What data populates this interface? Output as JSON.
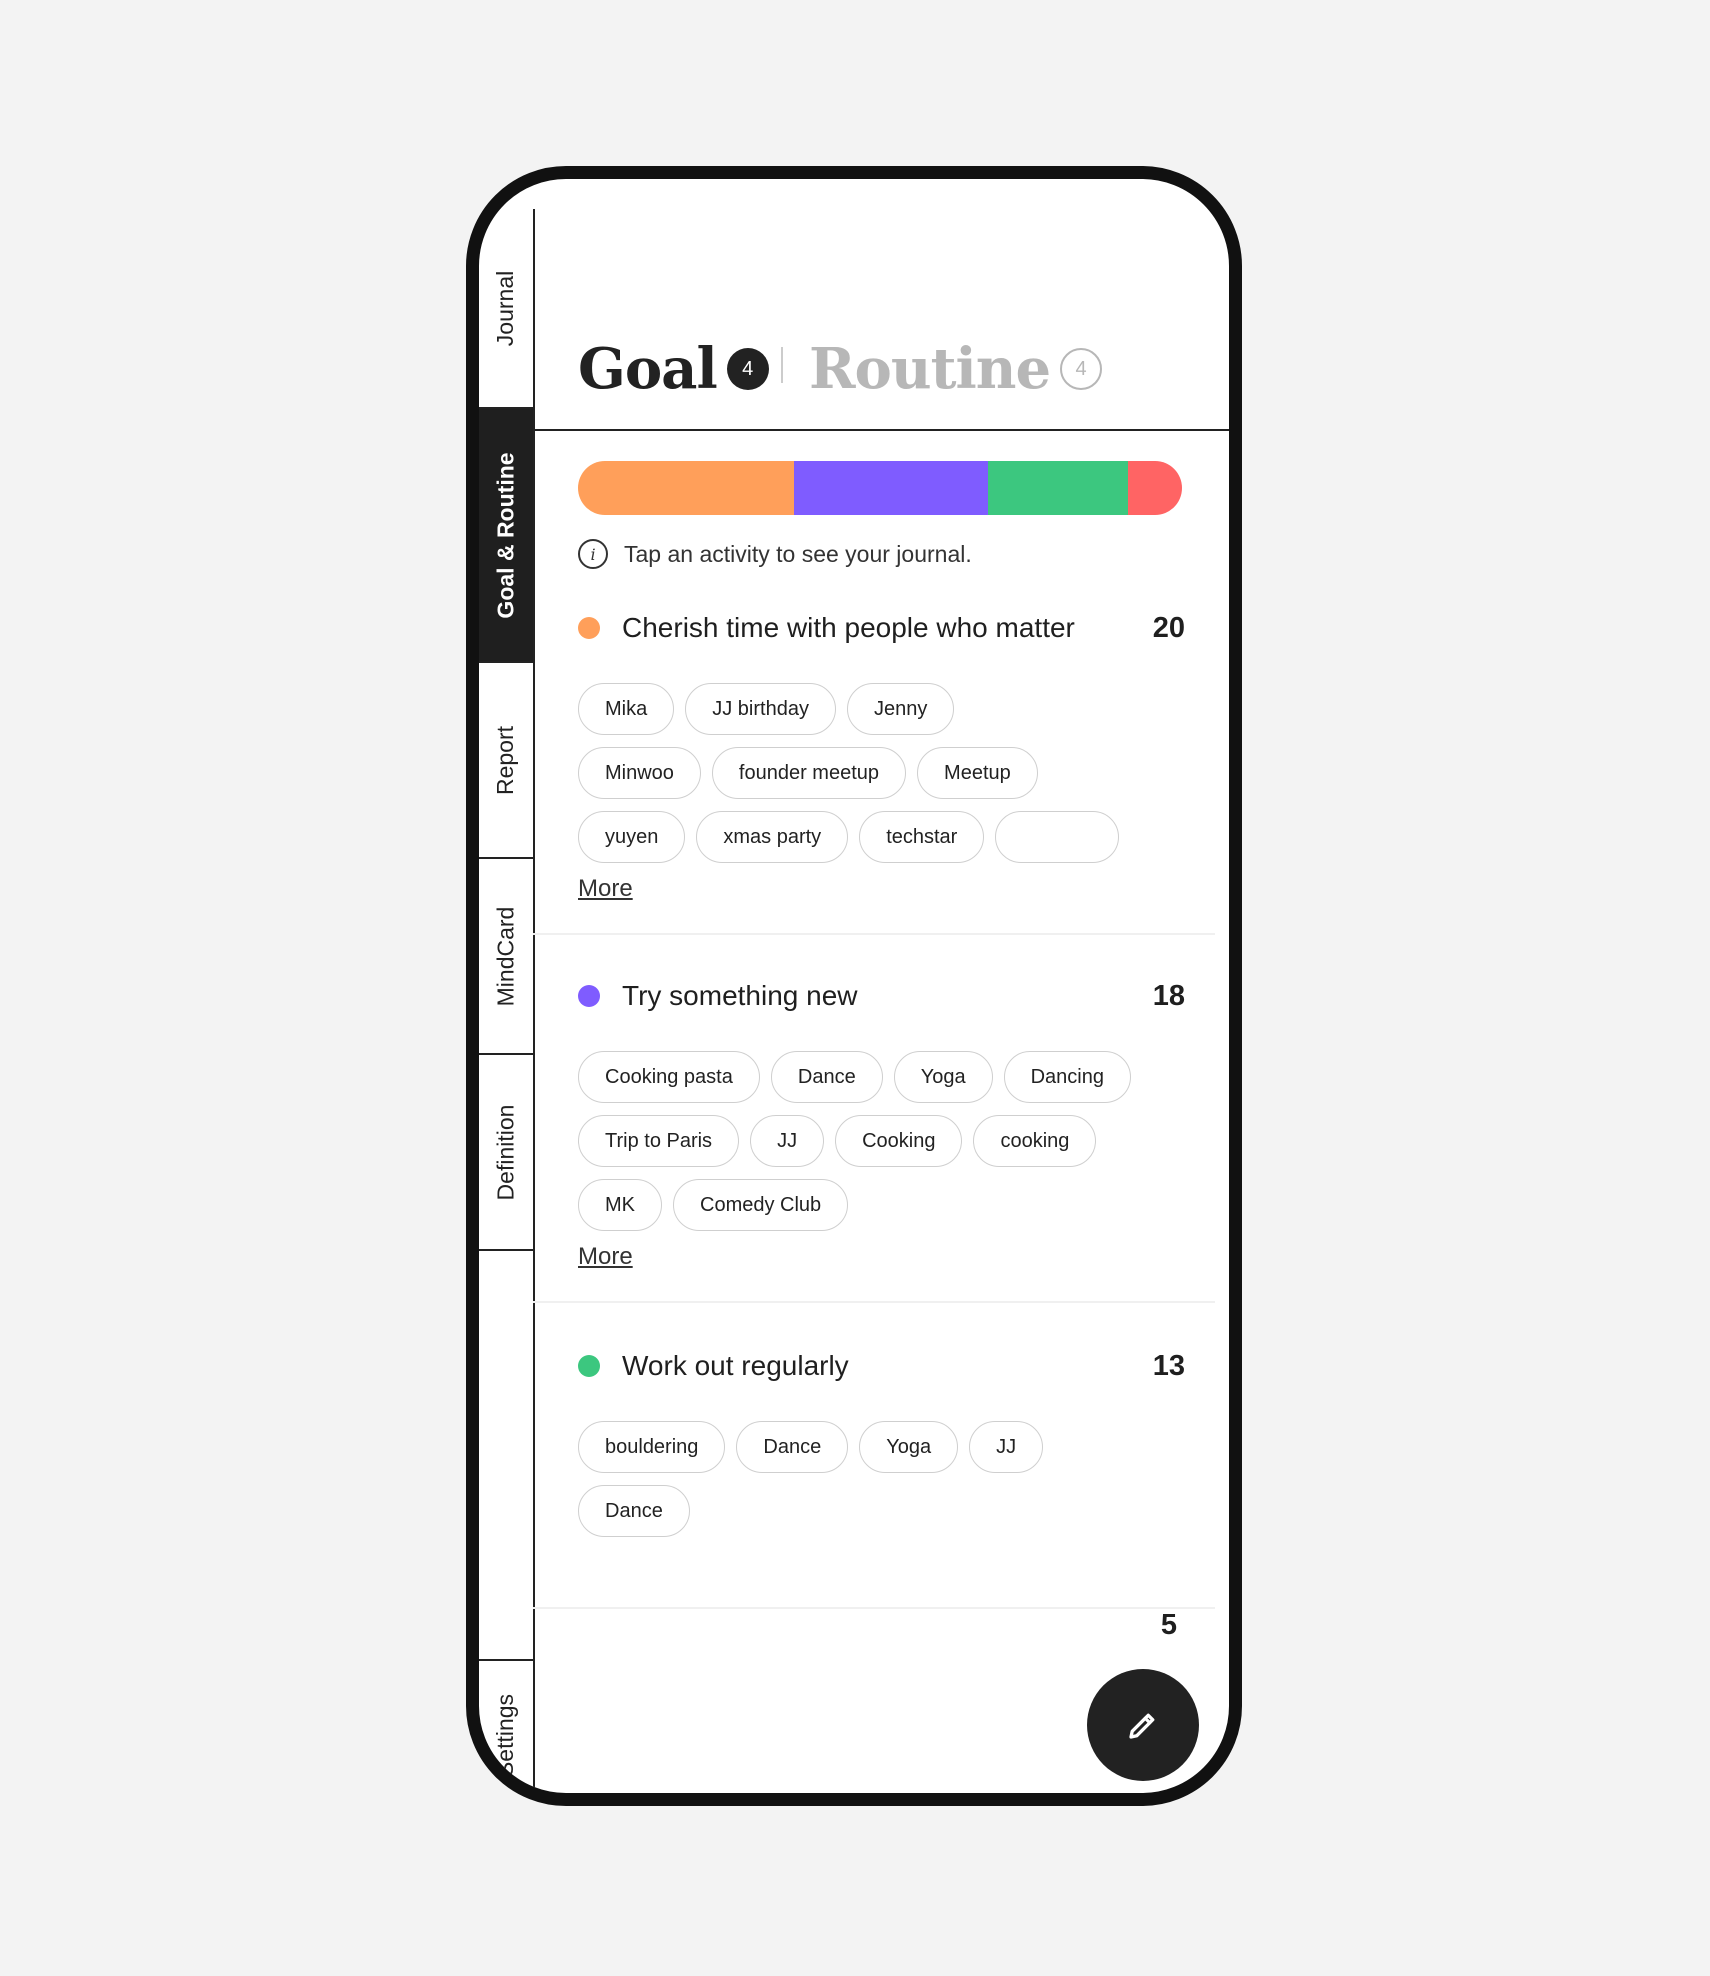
{
  "nav": {
    "items": [
      {
        "label": "Journal"
      },
      {
        "label": "Goal & Routine"
      },
      {
        "label": "Report"
      },
      {
        "label": "MindCard"
      },
      {
        "label": "Definition"
      },
      {
        "label": "Settings"
      }
    ]
  },
  "header": {
    "tabs": [
      {
        "label": "Goal",
        "badge": "4"
      },
      {
        "label": "Routine",
        "badge": "4"
      }
    ]
  },
  "progress": {
    "segments": [
      {
        "color": "#ff9f5a",
        "value": 20
      },
      {
        "color": "#7f5cff",
        "value": 18
      },
      {
        "color": "#3cc77f",
        "value": 13
      },
      {
        "color": "#ff6464",
        "value": 5
      }
    ]
  },
  "info": {
    "icon": "info-icon",
    "text": "Tap an activity to see your journal."
  },
  "goals": [
    {
      "title": "Cherish time with people who matter",
      "count": "20",
      "color": "#ff9f5a",
      "tags": [
        [
          "Mika",
          "JJ birthday",
          "Jenny"
        ],
        [
          "Minwoo",
          "founder meetup",
          "Meetup"
        ],
        [
          "yuyen",
          "xmas party",
          "techstar",
          ""
        ]
      ],
      "more": "More"
    },
    {
      "title": "Try something new",
      "count": "18",
      "color": "#7f5cff",
      "tags": [
        [
          "Cooking pasta",
          "Dance",
          "Yoga",
          "Dancing"
        ],
        [
          "Trip to Paris",
          "JJ",
          "Cooking",
          "cooking"
        ],
        [
          "MK",
          "Comedy Club"
        ]
      ],
      "more": "More"
    },
    {
      "title": "Work out regularly",
      "count": "13",
      "color": "#3cc77f",
      "tags": [
        [
          "bouldering",
          "Dance",
          "Yoga",
          "JJ"
        ],
        [
          "Dance"
        ]
      ]
    }
  ],
  "fourth_goal": {
    "count": "5"
  },
  "fab": {
    "icon": "pencil-icon"
  }
}
